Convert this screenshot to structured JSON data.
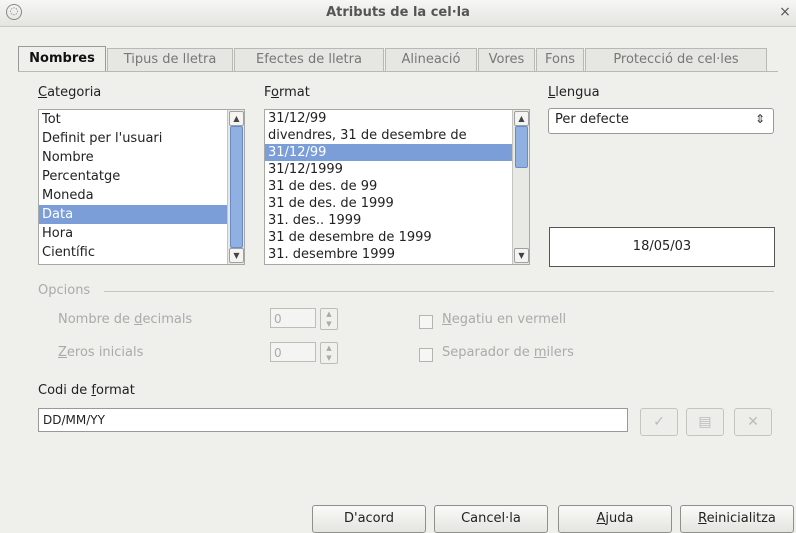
{
  "window": {
    "title": "Atributs de la cel·la",
    "menu_icon": "window-menu-icon",
    "close_glyph": "×"
  },
  "tabs": [
    {
      "label": "Nombres",
      "active": true
    },
    {
      "label": "Tipus de lletra"
    },
    {
      "label": "Efectes de lletra"
    },
    {
      "label": "Alineació"
    },
    {
      "label": "Vores"
    },
    {
      "label": "Fons"
    },
    {
      "label": "Protecció de cel·les"
    }
  ],
  "category": {
    "label_prefix": "",
    "label_u": "C",
    "label_rest": "ategoria",
    "items": [
      "Tot",
      "Definit per l'usuari",
      "Nombre",
      "Percentatge",
      "Moneda",
      "Data",
      "Hora",
      "Científic"
    ],
    "selected_index": 5
  },
  "format": {
    "label_prefix": "F",
    "label_u": "o",
    "label_rest": "rmat",
    "items": [
      "31/12/99",
      "divendres, 31 de desembre de",
      "31/12/99",
      "31/12/1999",
      "31 de des. de 99",
      "31 de des. de 1999",
      "31. des.. 1999",
      "31 de desembre de 1999",
      "31. desembre 1999"
    ],
    "selected_index": 2
  },
  "language": {
    "label_prefix": "",
    "label_u": "L",
    "label_rest": "lengua",
    "value": "Per defecte"
  },
  "preview": {
    "value": "18/05/03"
  },
  "options": {
    "legend": "Opcions",
    "decimals_prefix": "Nombre de ",
    "decimals_u": "d",
    "decimals_rest": "ecimals",
    "decimals_value": "0",
    "zeros_prefix": "",
    "zeros_u": "Z",
    "zeros_rest": "eros inicials",
    "zeros_value": "0",
    "negative_prefix": "",
    "negative_u": "N",
    "negative_rest": "egatiu en vermell",
    "thousands_prefix": "Separador de ",
    "thousands_u": "m",
    "thousands_rest": "ilers"
  },
  "code": {
    "label_prefix": "Codi de ",
    "label_u": "f",
    "label_rest": "ormat",
    "value": "DD/MM/YY",
    "accept_glyph": "✓",
    "edit_glyph": "▤",
    "delete_glyph": "✕"
  },
  "buttons": {
    "ok": "D'acord",
    "cancel": "Cancel·la",
    "help_u": "A",
    "help_rest": "juda",
    "reset_u": "R",
    "reset_rest": "einicialitza"
  }
}
